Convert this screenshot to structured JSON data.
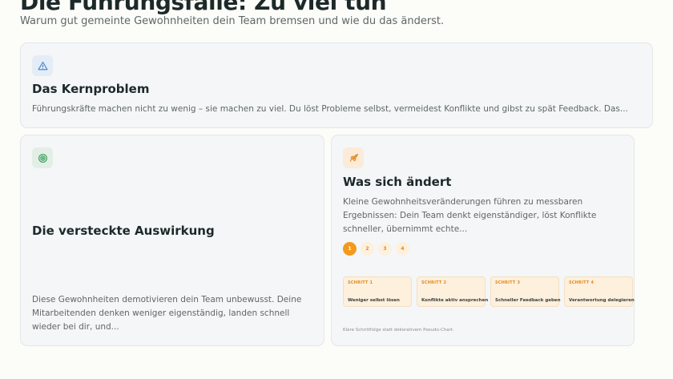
{
  "header": {
    "title": "Die Führungsfalle: Zu viel tun",
    "subtitle": "Warum gut gemeinte Gewohnheiten dein Team bremsen und wie du das änderst."
  },
  "cards": {
    "core_problem": {
      "icon": "warning-triangle-icon",
      "title": "Das Kernproblem",
      "text": "Führungskräfte machen nicht zu wenig – sie machen zu viel. Du löst Probleme selbst, vermeidest Konflikte und gibst zu spät Feedback. Das..."
    },
    "hidden_impact": {
      "icon": "target-icon",
      "title": "Die versteckte Auswirkung",
      "text": "Diese Gewohnheiten demotivieren dein Team unbewusst. Deine Mitarbeitenden denken weniger eigenständig, landen schnell wieder bei dir, und..."
    },
    "what_changes": {
      "icon": "rocket-icon",
      "title": "Was sich ändert",
      "text": "Kleine Gewohnheitsveränderungen führen zu messbaren Ergebnissen: Dein Team denkt eigenständiger, löst Konflikte schneller, übernimmt echte...",
      "step_dots": [
        "1",
        "2",
        "3",
        "4"
      ],
      "active_step": "1",
      "steps": [
        {
          "label": "SCHRITT 1",
          "text": "Weniger selbst lösen"
        },
        {
          "label": "SCHRITT 2",
          "text": "Konflikte aktiv ansprechen"
        },
        {
          "label": "SCHRITT 3",
          "text": "Schneller Feedback geben"
        },
        {
          "label": "SCHRITT 4",
          "text": "Verantwortung delegieren"
        }
      ],
      "footnote": "Klare Schrittfolge statt dekorativem Pseudo-Chart."
    }
  },
  "colors": {
    "accent_orange": "#f39a1e",
    "background": "#fcfcf9",
    "card_background": "#f5f6f7"
  }
}
